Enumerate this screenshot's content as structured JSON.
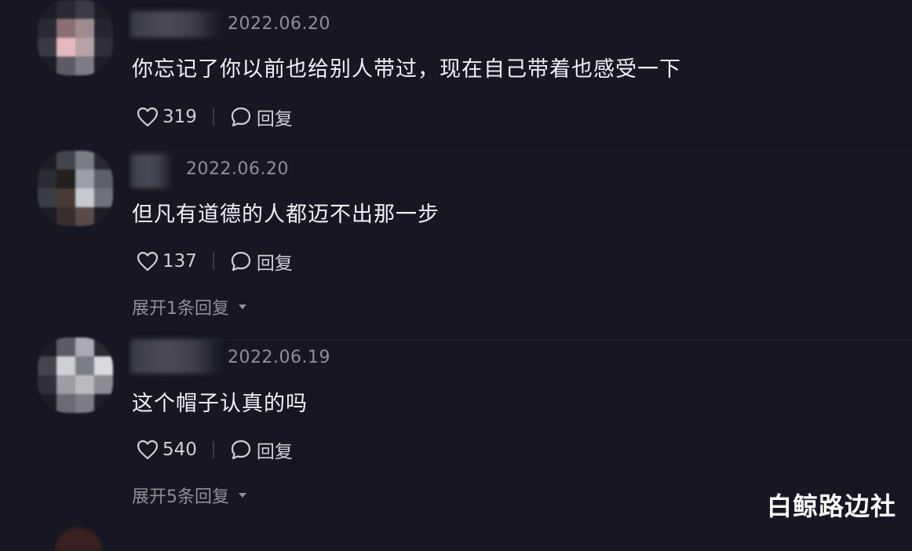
{
  "comments": [
    {
      "date": "2022.06.20",
      "text": "你忘记了你以前也给别人带过，现在自己带着也感受一下",
      "likes": "319",
      "reply_label": "回复"
    },
    {
      "date": "2022.06.20",
      "text": "但凡有道德的人都迈不出那一步",
      "likes": "137",
      "reply_label": "回复",
      "expand_label": "展开1条回复"
    },
    {
      "date": "2022.06.19",
      "text": "这个帽子认真的吗",
      "likes": "540",
      "reply_label": "回复",
      "expand_label": "展开5条回复"
    }
  ],
  "watermark": "白鲸路边社",
  "colors": {
    "background": "#161722",
    "text": "#f1f1f4",
    "muted": "#8e8f99",
    "action": "#cfd0d6"
  },
  "icons": {
    "like": "heart-outline-icon",
    "reply": "speech-bubble-icon",
    "expand": "caret-down-icon"
  }
}
